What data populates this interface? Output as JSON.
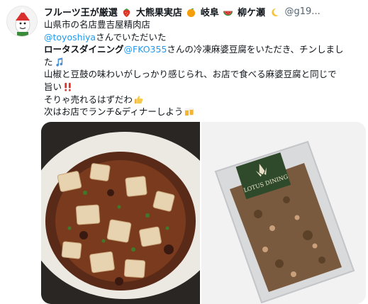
{
  "tweet": {
    "author": {
      "name_part1": "フルーツ王が厳選",
      "name_part2": "大熊果実店",
      "name_part3": "岐阜",
      "name_part4": "柳ケ瀬",
      "handle": "@g19...",
      "icons": [
        "strawberry-emoji",
        "orange-emoji",
        "watermelon-emoji",
        "moon-emoji"
      ]
    },
    "lines": {
      "l1": "山県市の名店豊吉屋精肉店",
      "l2_mention": "@toyoshiya",
      "l2_text": " さんでいただいた",
      "l3_bold": "ロータスダイニング",
      "l3_mention": "@FKO355",
      "l3_text": " さんの冷凍麻婆豆腐をいただき、チンしまし",
      "l3b_text": "た",
      "l4_text": "山椒と豆鼓の味わいがしっかり感じられ、お店で食べる麻婆豆腐と同じで",
      "l5_text": "旨い",
      "l6_text": "そりゃ売れるはずだわ",
      "l7_text": "次はお店でランチ&ディナーしよう"
    },
    "media": {
      "right_package_label": "LOTUS DINING",
      "images": [
        "mapo-tofu-plate-photo",
        "frozen-mapo-tofu-package-photo"
      ]
    },
    "colors": {
      "link": "#1d9bf0",
      "text": "#0f1419",
      "muted": "#536471"
    }
  }
}
